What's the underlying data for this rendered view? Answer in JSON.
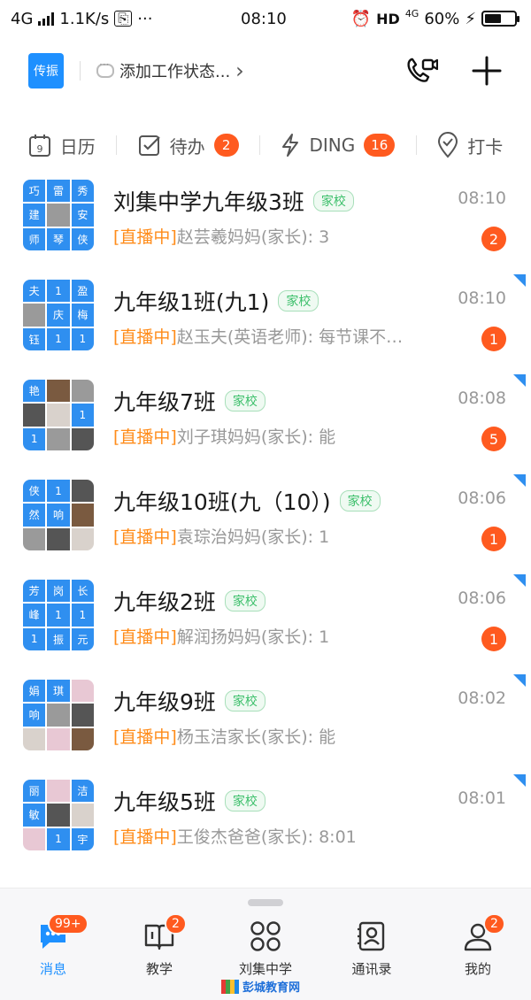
{
  "status_bar": {
    "network": "4G",
    "speed": "1.1K/s",
    "time": "08:10",
    "hd": "HD",
    "signal_type": "4G",
    "battery": "60%",
    "battery_level": 0.6
  },
  "header": {
    "fax_label": "传振",
    "work_status": "添加工作状态...",
    "work_status_chevron": "›"
  },
  "quick_bar": {
    "calendar": "日历",
    "todo": "待办",
    "todo_count": "2",
    "ding": "DING",
    "ding_count": "16",
    "checkin": "打卡"
  },
  "conversations": [
    {
      "title": "刘集中学九年级3班",
      "tag": "家校",
      "time": "08:10",
      "live": "[直播中]",
      "preview": "赵芸羲妈妈(家长): 3",
      "unread": "2",
      "avatar_chars": [
        "巧",
        "雷",
        "秀",
        "建",
        "",
        "安",
        "师",
        "琴",
        "侠"
      ]
    },
    {
      "title": "九年级1班(九1)",
      "tag": "家校",
      "time": "08:10",
      "live": "[直播中]",
      "preview": "赵玉夫(英语老师): 每节课不…",
      "unread": "1",
      "avatar_chars": [
        "夫",
        "1",
        "盈",
        "",
        "庆",
        "梅",
        "钰",
        "1",
        "1"
      ]
    },
    {
      "title": "九年级7班",
      "tag": "家校",
      "time": "08:08",
      "live": "[直播中]",
      "preview": "刘子琪妈妈(家长): 能",
      "unread": "5",
      "avatar_chars": [
        "艳",
        "",
        "",
        "",
        "",
        "1",
        "1",
        "",
        ""
      ]
    },
    {
      "title": "九年级10班(九（10）)",
      "tag": "家校",
      "time": "08:06",
      "live": "[直播中]",
      "preview": "袁琮治妈妈(家长): 1",
      "unread": "1",
      "avatar_chars": [
        "侠",
        "1",
        "",
        "然",
        "响",
        "",
        "",
        "",
        ""
      ]
    },
    {
      "title": "九年级2班",
      "tag": "家校",
      "time": "08:06",
      "live": "[直播中]",
      "preview": "解润扬妈妈(家长): 1",
      "unread": "1",
      "avatar_chars": [
        "芳",
        "岗",
        "长",
        "峰",
        "1",
        "1",
        "1",
        "振",
        "元"
      ]
    },
    {
      "title": "九年级9班",
      "tag": "家校",
      "time": "08:02",
      "live": "[直播中]",
      "preview": "杨玉洁家长(家长): 能",
      "unread": "",
      "avatar_chars": [
        "娟",
        "琪",
        "",
        "响",
        "",
        "",
        "",
        "",
        ""
      ]
    },
    {
      "title": "九年级5班",
      "tag": "家校",
      "time": "08:01",
      "live": "[直播中]",
      "preview": "王俊杰爸爸(家长): 8:01",
      "unread": "",
      "avatar_chars": [
        "丽",
        "",
        "洁",
        "敏",
        "",
        "",
        "",
        "1",
        "宇"
      ]
    }
  ],
  "bottom_nav": {
    "messages": "消息",
    "messages_badge": "99+",
    "teaching": "教学",
    "teaching_badge": "2",
    "school": "刘集中学",
    "contacts": "通讯录",
    "mine": "我的",
    "mine_badge": "2"
  },
  "watermark": "彭城教育网",
  "colors": {
    "accent": "#1e90ff",
    "badge": "#ff5a1f",
    "live": "#ff8c1a",
    "tag_green": "#3bbf6a"
  }
}
